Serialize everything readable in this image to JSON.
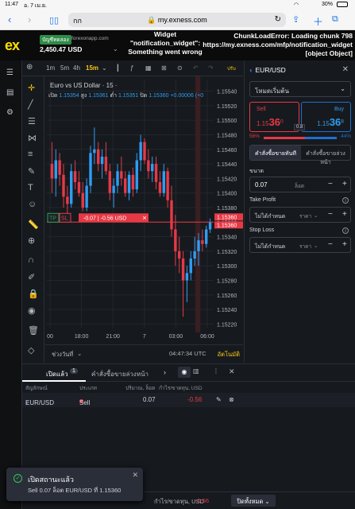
{
  "ios": {
    "time": "11:47",
    "date": "อ. 7 เม.ย.",
    "battery": "30%"
  },
  "browser": {
    "aa": "กก",
    "url": "my.exness.com"
  },
  "header": {
    "logo": "ex",
    "account_type": "บัญชีทดลอง",
    "server": "forexonapp.com",
    "balance": "2,450.47 USD",
    "error_widget": "Widget \"notification_widget\": Something went wrong",
    "error_chunk": "ChunkLoadError: Loading chunk 798 https://my.exness.com/mfp/notification_widget [object Object]"
  },
  "toolbar": {
    "add": "⊕",
    "tf1": "1m",
    "tf2": "5m",
    "tf3": "4h",
    "tf_active": "15m",
    "more_label": "ปรับ"
  },
  "chart": {
    "title": "Euro vs US Dollar · 15 ·",
    "open_lbl": "เปิด",
    "open": "1.15354",
    "high_lbl": "สูง",
    "high": "1.15361",
    "low_lbl": "ต่ำ",
    "low": "1.15351",
    "close_lbl": "ปิด",
    "close": "1.15360",
    "change": "+0.00006 (+0",
    "bid_tag": "1.15360",
    "ask_tag": "1.15360",
    "tp_label": "TP",
    "sl_label": "SL",
    "pos_pl": "-0.07",
    "pos_usd": "-0.56 USD"
  },
  "chart_data": {
    "type": "candlestick",
    "title": "Euro vs US Dollar · 15",
    "x_ticks": [
      "00",
      "18:00",
      "21:00",
      "7",
      "03:00",
      "06:00"
    ],
    "y_ticks": [
      "1.15540",
      "1.15520",
      "1.15500",
      "1.15480",
      "1.15460",
      "1.15440",
      "1.15420",
      "1.15400",
      "1.15380",
      "1.15360",
      "1.15340",
      "1.15320",
      "1.15300",
      "1.15280",
      "1.15260",
      "1.15240",
      "1.15220"
    ],
    "ylim": [
      1.15215,
      1.15545
    ],
    "candles": [
      [
        1.1544,
        1.1547,
        1.154,
        1.1542
      ],
      [
        1.1542,
        1.1546,
        1.15395,
        1.15445
      ],
      [
        1.15445,
        1.15455,
        1.1541,
        1.15425
      ],
      [
        1.15425,
        1.1544,
        1.1538,
        1.15395
      ],
      [
        1.15395,
        1.1541,
        1.1537,
        1.15385
      ],
      [
        1.15385,
        1.1544,
        1.1538,
        1.1543
      ],
      [
        1.1543,
        1.15445,
        1.15405,
        1.15415
      ],
      [
        1.15415,
        1.1543,
        1.15395,
        1.154
      ],
      [
        1.154,
        1.15415,
        1.15375,
        1.1538
      ],
      [
        1.1538,
        1.1542,
        1.15375,
        1.1541
      ],
      [
        1.1541,
        1.15465,
        1.154,
        1.15455
      ],
      [
        1.15455,
        1.1549,
        1.1544,
        1.1546
      ],
      [
        1.1546,
        1.1547,
        1.1543,
        1.1544
      ],
      [
        1.1544,
        1.1546,
        1.1542,
        1.1545
      ],
      [
        1.1545,
        1.1547,
        1.15425,
        1.1543
      ],
      [
        1.1543,
        1.1544,
        1.1539,
        1.154
      ],
      [
        1.154,
        1.1542,
        1.1538,
        1.1541
      ],
      [
        1.1541,
        1.1544,
        1.154,
        1.1543
      ],
      [
        1.1543,
        1.1545,
        1.1541,
        1.1542
      ],
      [
        1.1542,
        1.1543,
        1.15395,
        1.154
      ],
      [
        1.154,
        1.1543,
        1.1539,
        1.15425
      ],
      [
        1.15425,
        1.15435,
        1.15395,
        1.15405
      ],
      [
        1.15405,
        1.15455,
        1.154,
        1.15445
      ],
      [
        1.15445,
        1.1548,
        1.1543,
        1.1547
      ],
      [
        1.1547,
        1.15475,
        1.1544,
        1.15445
      ],
      [
        1.15445,
        1.1546,
        1.1542,
        1.1543
      ],
      [
        1.1543,
        1.1545,
        1.15415,
        1.1544
      ],
      [
        1.1544,
        1.1545,
        1.15405,
        1.15415
      ],
      [
        1.15415,
        1.1543,
        1.15395,
        1.154
      ],
      [
        1.154,
        1.1544,
        1.15395,
        1.1543
      ],
      [
        1.1543,
        1.15435,
        1.1538,
        1.1539
      ],
      [
        1.1539,
        1.1541,
        1.1534,
        1.1535
      ],
      [
        1.1535,
        1.1537,
        1.153,
        1.1532
      ],
      [
        1.1532,
        1.1534,
        1.1529,
        1.1531
      ],
      [
        1.1531,
        1.1532,
        1.1523,
        1.1528
      ],
      [
        1.1528,
        1.153,
        1.1525,
        1.1529
      ],
      [
        1.1529,
        1.1532,
        1.1528,
        1.1531
      ],
      [
        1.1531,
        1.1534,
        1.153,
        1.1532
      ],
      [
        1.1532,
        1.15345,
        1.153,
        1.15335
      ],
      [
        1.15335,
        1.1535,
        1.1532,
        1.1533
      ],
      [
        1.1533,
        1.15355,
        1.15325,
        1.1535
      ],
      [
        1.1535,
        1.15365,
        1.15345,
        1.1536
      ]
    ]
  },
  "timebar": {
    "range_label": "ช่วงวันที่",
    "clock": "04:47:34 UTC",
    "autofit": "อัตโนมัติ"
  },
  "trade": {
    "symbol": "EUR/USD",
    "mode": "โหมดเริ่มต้น",
    "sell_label": "Sell",
    "sell_prefix": "1.15",
    "sell_big": "36",
    "sell_sup": "0",
    "buy_label": "Buy",
    "buy_prefix": "1.15",
    "buy_big": "36",
    "buy_sup": "8",
    "spread": "0.8",
    "sent_sell": "56%",
    "sent_sell_frac": 0.56,
    "sent_buy": "44%",
    "sent_buy_frac": 0.44,
    "tab_market": "คำสั่งซื้อขายทันที",
    "tab_pending": "คำสั่งซื้อขายล่วงหน้า",
    "volume_label": "ขนาด",
    "volume": "0.07",
    "volume_unit": "ล็อต",
    "tp_label": "Take Profit",
    "tp_value": "ไม่ได้กำหนด",
    "tp_unit": "ราคา",
    "sl_label": "Stop Loss",
    "sl_value": "ไม่ได้กำหนด",
    "sl_unit": "ราคา"
  },
  "positions": {
    "tab_open": "เปิดแล้ว",
    "open_count": "1",
    "tab_pending": "คำสั่งซื้อขายล่วงหน้า",
    "col_symbol": "สัญลักษณ์",
    "col_type": "ประเภท",
    "col_volume": "ปริมาณ, ล็อต",
    "col_pl": "กำไร/ขาดทุน, USD",
    "row": {
      "symbol": "EUR/USD",
      "type": "Sell",
      "volume": "0.07",
      "pl": "-0.56"
    }
  },
  "bottombar": {
    "pl_label": "กำไร/ขาดทุน, USD",
    "pl_value": "-0.56",
    "close_all": "ปิดทั้งหมด"
  },
  "toast": {
    "title": "เปิดสถานะแล้ว",
    "msg": "Sell 0.07 ล็อต EUR/USD ที่ 1.15360"
  },
  "colors": {
    "up": "#2f9df4",
    "down": "#e63946",
    "accent": "#ffde02",
    "bg": "#161a1e"
  }
}
